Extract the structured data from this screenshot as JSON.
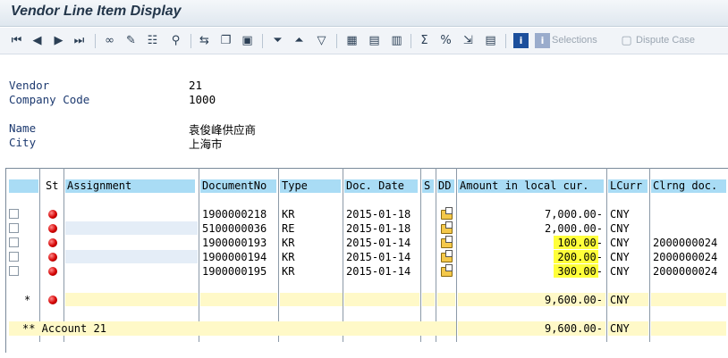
{
  "title": "Vendor Line Item Display",
  "toolbar": {
    "selections_label": "Selections",
    "dispute_case_label": "Dispute Case"
  },
  "header": {
    "vendor_label": "Vendor",
    "vendor_value": "21",
    "company_code_label": "Company Code",
    "company_code_value": "1000",
    "name_label": "Name",
    "name_value": "袁俊峰供应商",
    "city_label": "City",
    "city_value": "上海市"
  },
  "table": {
    "columns": [
      "St",
      "Assignment",
      "DocumentNo",
      "Type",
      "Doc. Date",
      "S",
      "DD",
      "Amount in local cur.",
      "LCurr",
      "Clrng doc."
    ],
    "rows": [
      {
        "doc_no": "1900000218",
        "type": "KR",
        "date": "2015-01-18",
        "amount": "7,000.00-",
        "curr": "CNY",
        "clrng": "",
        "highlight": false
      },
      {
        "doc_no": "5100000036",
        "type": "RE",
        "date": "2015-01-18",
        "amount": "2,000.00-",
        "curr": "CNY",
        "clrng": "",
        "highlight": false
      },
      {
        "doc_no": "1900000193",
        "type": "KR",
        "date": "2015-01-14",
        "amount": "100.00-",
        "curr": "CNY",
        "clrng": "2000000024",
        "highlight": true
      },
      {
        "doc_no": "1900000194",
        "type": "KR",
        "date": "2015-01-14",
        "amount": "200.00-",
        "curr": "CNY",
        "clrng": "2000000024",
        "highlight": true
      },
      {
        "doc_no": "1900000195",
        "type": "KR",
        "date": "2015-01-14",
        "amount": "300.00-",
        "curr": "CNY",
        "clrng": "2000000024",
        "highlight": true
      }
    ],
    "total_marker": "*",
    "total_amount": "9,600.00-",
    "total_curr": "CNY",
    "account_label": "** Account 21",
    "account_amount": "9,600.00-",
    "account_curr": "CNY"
  }
}
